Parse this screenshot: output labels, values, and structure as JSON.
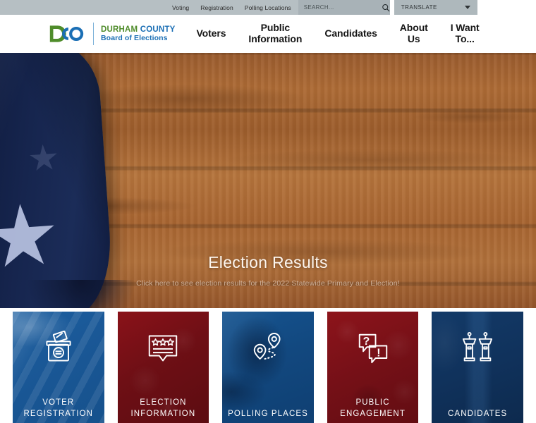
{
  "utility_bar": {
    "links": [
      {
        "label": "Voting",
        "name": "util-link-voting"
      },
      {
        "label": "Registration",
        "name": "util-link-registration"
      },
      {
        "label": "Polling Locations",
        "name": "util-link-polling-locations"
      }
    ],
    "search": {
      "placeholder": "SEARCH...",
      "value": "",
      "icon": "search-icon"
    },
    "translate": {
      "label": "TRANSLATE",
      "icon": "chevron-down-icon"
    }
  },
  "header": {
    "logo": {
      "icon": "dco-logo-icon"
    },
    "brand": {
      "durham": "DURHAM",
      "county": " COUNTY",
      "subtitle": "Board of Elections"
    },
    "nav": [
      {
        "label": "Voters",
        "name": "nav-item-voters"
      },
      {
        "label": "Public\nInformation",
        "line1": "Public",
        "line2": "Information",
        "name": "nav-item-public-information"
      },
      {
        "label": "Candidates",
        "name": "nav-item-candidates"
      },
      {
        "label": "About\nUs",
        "line1": "About",
        "line2": "Us",
        "name": "nav-item-about-us"
      },
      {
        "label": "I Want\nTo...",
        "line1": "I Want",
        "line2": "To...",
        "name": "nav-item-i-want-to"
      }
    ]
  },
  "hero": {
    "title": "Election Results",
    "subtitle": "Click here to see election results for the 2022 Statewide Primary and Election!",
    "slides": [
      {
        "active": true
      },
      {
        "active": false
      }
    ]
  },
  "cards": [
    {
      "line1": "VOTER",
      "line2": "REGISTRATION",
      "icon": "ballot-box-icon",
      "theme": "voter",
      "name": "card-voter-registration"
    },
    {
      "line1": "ELECTION",
      "line2": "INFORMATION",
      "icon": "stars-banner-icon",
      "theme": "election",
      "name": "card-election-information"
    },
    {
      "line1": "POLLING PLACES",
      "line2": "",
      "icon": "map-pins-route-icon",
      "theme": "polling",
      "name": "card-polling-places"
    },
    {
      "line1": "PUBLIC",
      "line2": "ENGAGEMENT",
      "icon": "speech-bubbles-icon",
      "theme": "public",
      "name": "card-public-engagement"
    },
    {
      "line1": "CANDIDATES",
      "line2": "",
      "icon": "podiums-icon",
      "theme": "candidates",
      "name": "card-candidates"
    }
  ],
  "colors": {
    "utility_bar_bg": "#b6bfc3",
    "search_bg": "#a8b2b7",
    "brand_green": "#4f8c2b",
    "brand_blue": "#1b6fb5",
    "card_red": "#7b1118",
    "card_blue": "#1a5897",
    "card_navy": "#10325c"
  }
}
